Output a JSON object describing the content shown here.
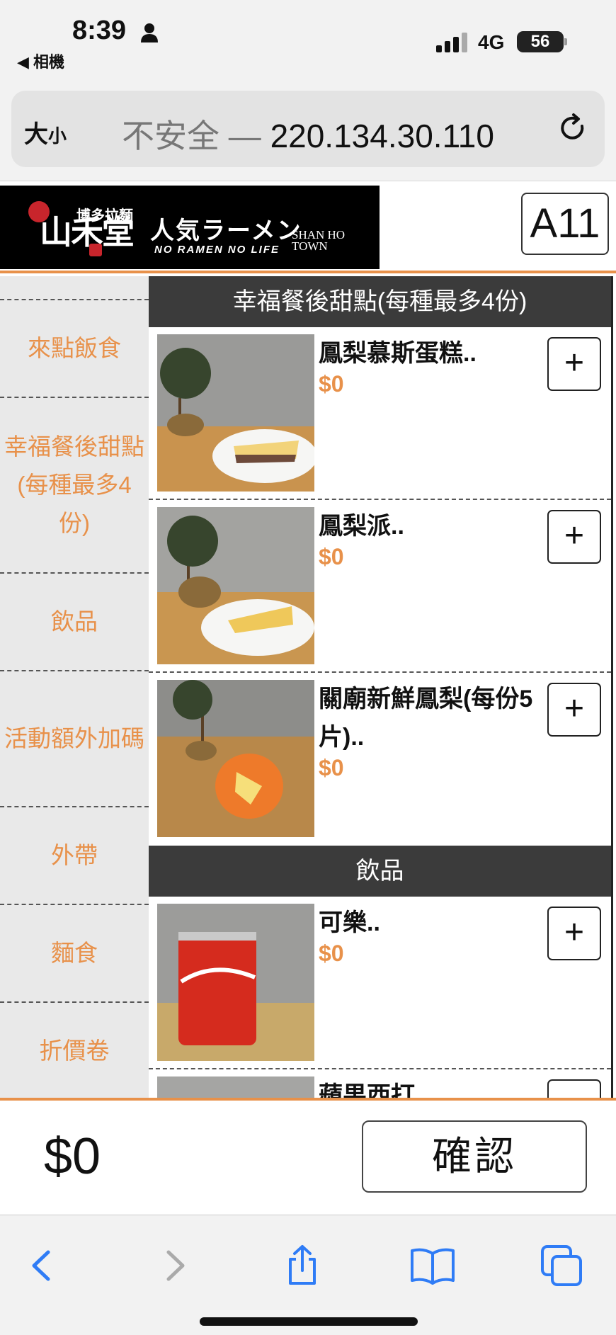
{
  "status": {
    "time": "8:39",
    "back_app": "◀ 相機",
    "network": "4G",
    "battery": "56"
  },
  "address": {
    "text_size": "大",
    "text_size_small": "小",
    "insecure": "不安全 — ",
    "host": "220.134.30.110"
  },
  "header": {
    "table_no": "A11",
    "logo_top": "博多拉麵",
    "logo_name": "山禾堂",
    "jp_title": "人気ラーメン",
    "slogan": "NO RAMEN NO LIFE",
    "town": "SHAN HO TOWN"
  },
  "sidebar": {
    "items": [
      {
        "label": "來點飯食"
      },
      {
        "label": "幸福餐後甜點(每種最多4份)"
      },
      {
        "label": "飲品"
      },
      {
        "label": "活動額外加碼"
      },
      {
        "label": "外帶"
      },
      {
        "label": "麵食"
      },
      {
        "label": "折價卷"
      }
    ]
  },
  "sections": [
    {
      "title": "幸福餐後甜點(每種最多4份)",
      "products": [
        {
          "name": "鳳梨慕斯蛋糕..",
          "price": "$0",
          "add_label": "+"
        },
        {
          "name": "鳳梨派..",
          "price": "$0",
          "add_label": "+"
        },
        {
          "name": "關廟新鮮鳳梨(每份5片)..",
          "price": "$0",
          "add_label": "+"
        }
      ]
    },
    {
      "title": "飲品",
      "products": [
        {
          "name": "可樂..",
          "price": "$0",
          "add_label": "+"
        },
        {
          "name": "蘋果西打",
          "price": "",
          "add_label": ""
        }
      ]
    }
  ],
  "footer": {
    "total": "$0",
    "confirm_label": "確認"
  },
  "colors": {
    "accent": "#e8914a",
    "section_bg": "#3b3b3b",
    "sidebar_bg": "#e9e9e9",
    "ios_blue": "#2f7cf6"
  },
  "toolbar_icons": [
    "back-icon",
    "forward-icon",
    "share-icon",
    "bookmarks-icon",
    "tabs-icon"
  ]
}
